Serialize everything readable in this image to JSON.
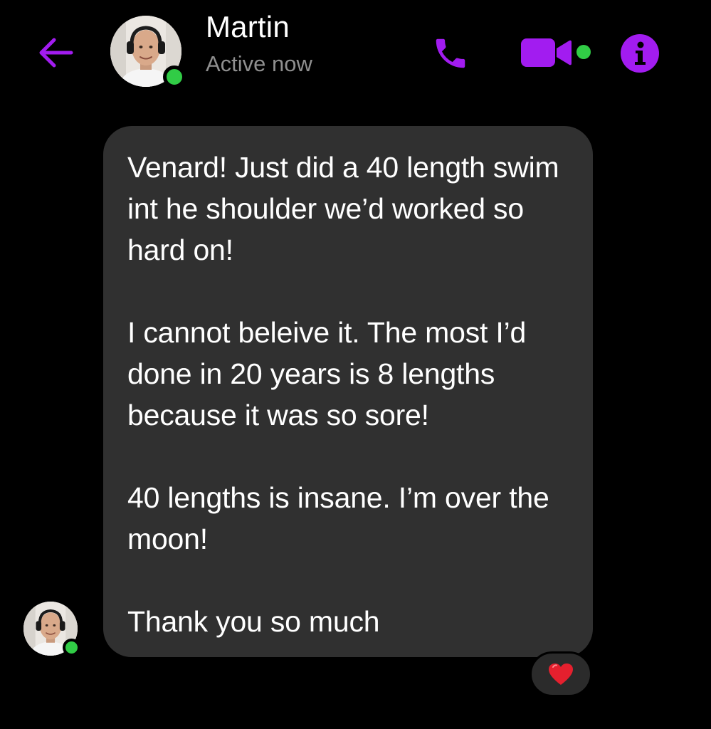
{
  "header": {
    "contact_name": "Martin",
    "status": "Active now",
    "presence": "online",
    "icons": {
      "back": "back-arrow-icon",
      "call": "phone-icon",
      "video": "video-camera-icon",
      "info": "info-icon"
    }
  },
  "message": {
    "paragraphs": [
      "Venard! Just did a 40 length swim int he shoulder we’d worked so hard on!",
      "I cannot beleive it. The most I’d done in 20 years is 8 lengths because it was so sore!",
      "40 lengths is insane. I’m over the moon!",
      "Thank you so much"
    ],
    "reaction": "❤️"
  },
  "colors": {
    "accent": "#a21cf0",
    "presence_green": "#31cc46",
    "bubble_bg": "#303030",
    "background": "#000000",
    "status_text": "#8f8f8f",
    "heart": "#e5202e"
  }
}
